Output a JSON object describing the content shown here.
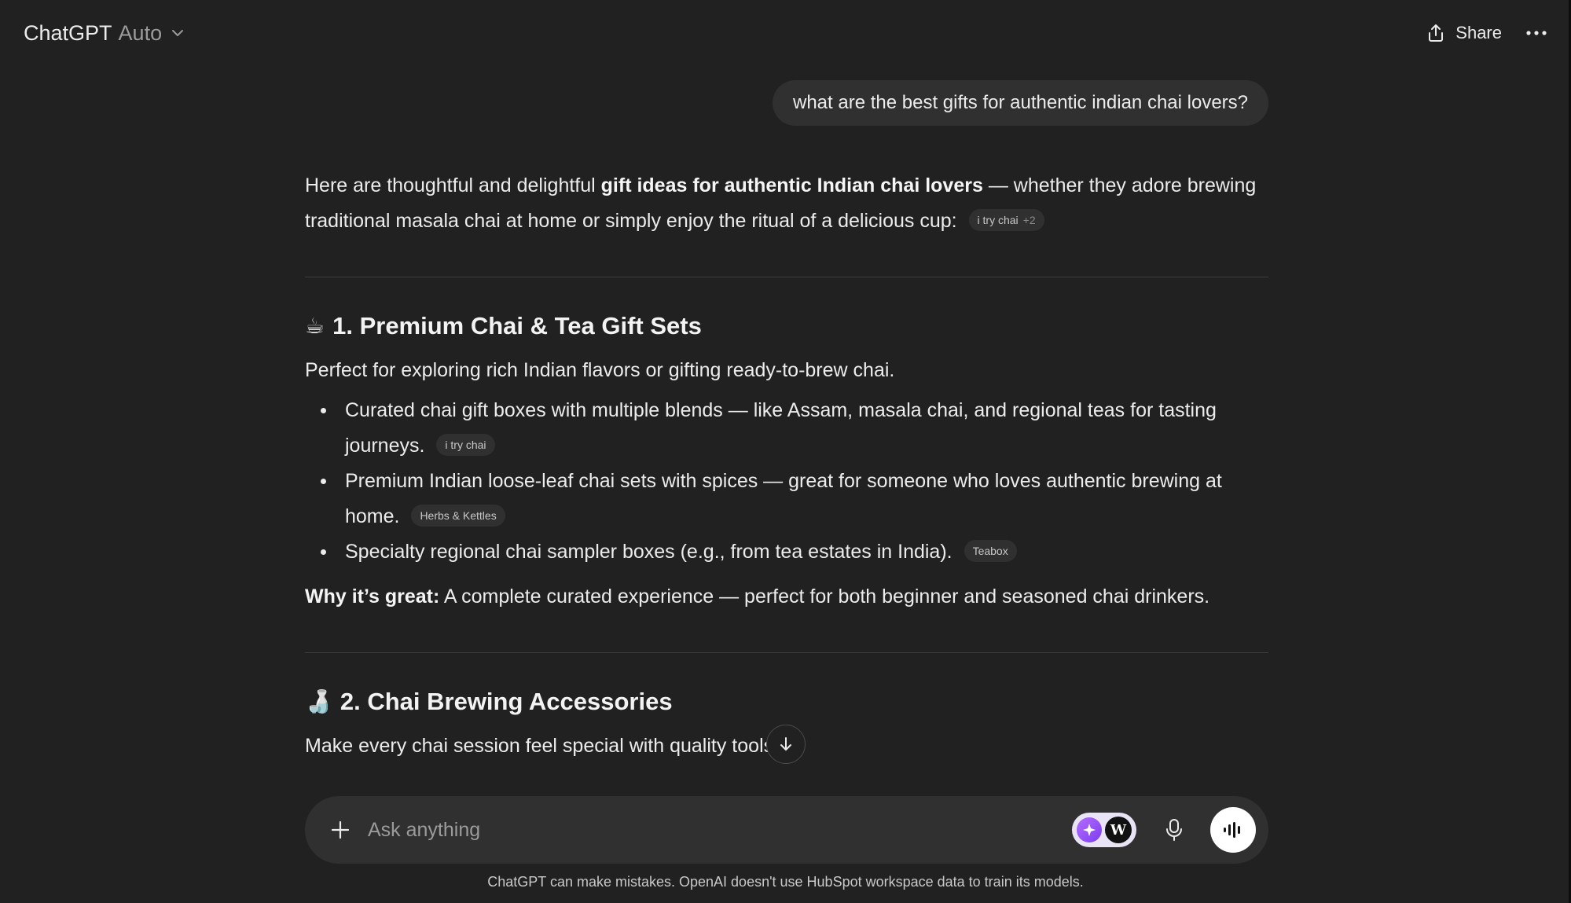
{
  "header": {
    "app_name": "ChatGPT",
    "model_variant": "Auto",
    "share_label": "Share"
  },
  "user_message": "what are the best gifts for authentic indian chai lovers?",
  "assistant": {
    "intro": {
      "before_bold": "Here are thoughtful and delightful ",
      "bold": "gift ideas for authentic Indian chai lovers",
      "after_bold": " — whether they adore brewing traditional masala chai at home or simply enjoy the ritual of a delicious cup:",
      "chip": {
        "label": "i try chai",
        "extra": "+2"
      }
    },
    "sections": [
      {
        "emoji": "☕",
        "title": "1. Premium Chai & Tea Gift Sets",
        "intro": "Perfect for exploring rich Indian flavors or gifting ready-to-brew chai.",
        "bullets": [
          {
            "text": "Curated chai gift boxes with multiple blends — like Assam, masala chai, and regional teas for tasting journeys.",
            "chip": "i try chai"
          },
          {
            "text": "Premium Indian loose-leaf chai sets with spices — great for someone who loves authentic brewing at home.",
            "chip": "Herbs & Kettles"
          },
          {
            "text": "Specialty regional chai sampler boxes (e.g., from tea estates in India).",
            "chip": "Teabox"
          }
        ],
        "why_label": "Why it’s great:",
        "why_text": " A complete curated experience — perfect for both beginner and seasoned chai drinkers."
      },
      {
        "emoji": "🍶",
        "title": "2. Chai Brewing Accessories",
        "intro": "Make every chai session feel special with quality tools."
      }
    ]
  },
  "composer": {
    "placeholder": "Ask anything",
    "ext_letter": "W"
  },
  "disclaimer": "ChatGPT can make mistakes. OpenAI doesn't use HubSpot workspace data to train its models.",
  "icons": {
    "model_dropdown": "chevron-down-icon",
    "share": "share-icon",
    "more": "more-horizontal-icon",
    "scroll": "arrow-down-icon",
    "attach": "plus-icon",
    "extension": "sparkle-icon",
    "mic": "microphone-icon",
    "voice": "voice-wave-icon"
  },
  "colors": {
    "background": "#212121",
    "bubble": "#303030",
    "text": "#ececec",
    "muted": "#9b9b9b"
  }
}
